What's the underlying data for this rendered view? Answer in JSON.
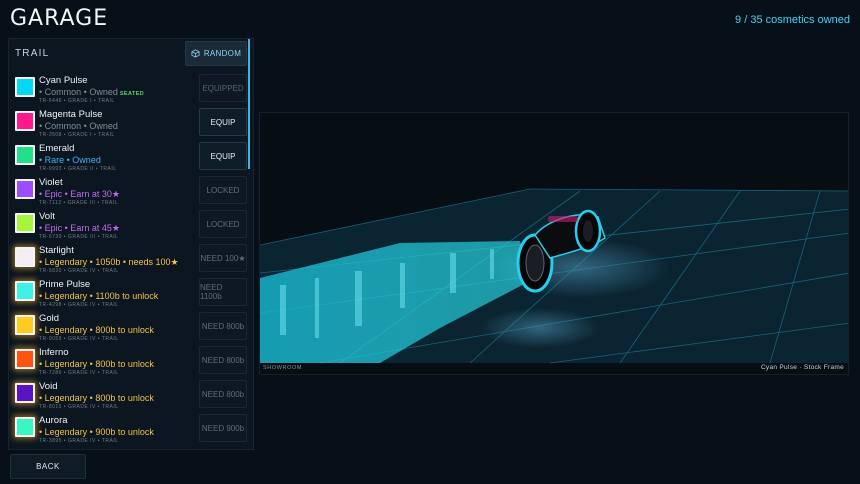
{
  "header": {
    "title": "GARAGE",
    "owned_count": "9 / 35 cosmetics owned"
  },
  "panel": {
    "title": "TRAIL",
    "random_label": "RANDOM",
    "random_icon": "cube-icon"
  },
  "items": [
    {
      "name": "Cyan Pulse",
      "meta": "• Common • Owned",
      "badge": "SEATED",
      "code": "TR-6446 • GRADE I • TRAIL",
      "color": "#00d8f5",
      "rarity": "common",
      "action": "EQUIPPED",
      "state": "equipped"
    },
    {
      "name": "Magenta Pulse",
      "meta": "• Common • Owned",
      "badge": "",
      "code": "TR-3508 • GRADE I • TRAIL",
      "color": "#ff1a8c",
      "rarity": "common",
      "action": "EQUIP",
      "state": "equip"
    },
    {
      "name": "Emerald",
      "meta": "• Rare • Owned",
      "badge": "",
      "code": "TR-9993 • GRADE II • TRAIL",
      "color": "#22e08a",
      "rarity": "rare",
      "action": "EQUIP",
      "state": "equip"
    },
    {
      "name": "Violet",
      "meta": "• Epic • Earn at 30★",
      "badge": "",
      "code": "TR-7112 • GRADE III • TRAIL",
      "color": "#9b4dff",
      "rarity": "epic",
      "action": "LOCKED",
      "state": "locked"
    },
    {
      "name": "Volt",
      "meta": "• Epic • Earn at 45★",
      "badge": "",
      "code": "TR-6730 • GRADE III • TRAIL",
      "color": "#a6f53a",
      "rarity": "epic",
      "action": "LOCKED",
      "state": "locked"
    },
    {
      "name": "Starlight",
      "meta": "• Legendary • 1050b • needs 100★",
      "badge": "",
      "code": "TR-6830 • GRADE IV • TRAIL",
      "color": "#f4eef4",
      "rarity": "legendary",
      "action": "NEED 100★",
      "state": "locked"
    },
    {
      "name": "Prime Pulse",
      "meta": "• Legendary • 1100b to unlock",
      "badge": "",
      "code": "TR-4298 • GRADE IV • TRAIL",
      "color": "#3ff0e6",
      "rarity": "legendary",
      "action": "NEED 1100b",
      "state": "locked"
    },
    {
      "name": "Gold",
      "meta": "• Legendary • 800b to unlock",
      "badge": "",
      "code": "TR-9059 • GRADE IV • TRAIL",
      "color": "#ffcc1f",
      "rarity": "legendary",
      "action": "NEED 800b",
      "state": "locked"
    },
    {
      "name": "Inferno",
      "meta": "• Legendary • 800b to unlock",
      "badge": "",
      "code": "TR-7286 • GRADE IV • TRAIL",
      "color": "#ff5410",
      "rarity": "legendary",
      "action": "NEED 800b",
      "state": "locked"
    },
    {
      "name": "Void",
      "meta": "• Legendary • 800b to unlock",
      "badge": "",
      "code": "TR-8015 • GRADE IV • TRAIL",
      "color": "#5a12c2",
      "rarity": "legendary",
      "action": "NEED 800b",
      "state": "locked"
    },
    {
      "name": "Aurora",
      "meta": "• Legendary • 900b to unlock",
      "badge": "",
      "code": "TR-3895 • GRADE IV • TRAIL",
      "color": "#3af5c4",
      "rarity": "legendary",
      "action": "NEED 900b",
      "state": "locked"
    }
  ],
  "showroom": {
    "label": "SHOWROOM",
    "caption": "Cyan Pulse  ·  Stock Frame",
    "trail_color": "#1fd6ea",
    "grid_color": "#1b6e86"
  },
  "footer": {
    "back_label": "BACK"
  }
}
